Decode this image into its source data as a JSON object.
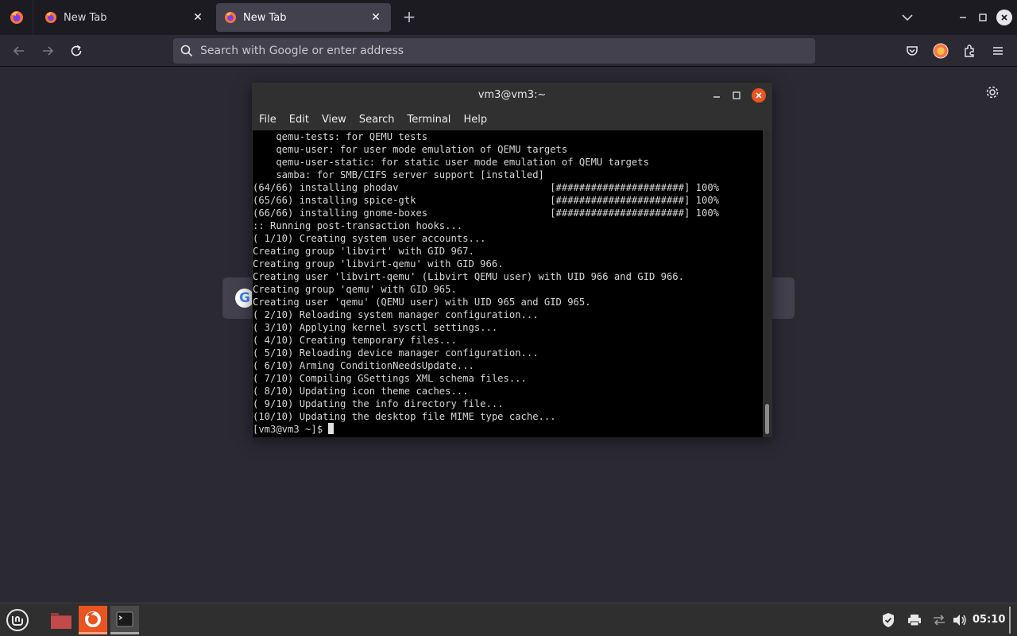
{
  "browser": {
    "tabs": [
      {
        "label": "New Tab",
        "active": false
      },
      {
        "label": "New Tab",
        "active": true
      }
    ],
    "new_tab_symbol": "+",
    "close_symbol": "✕",
    "urlbar": {
      "placeholder": "Search with Google or enter address",
      "value": ""
    },
    "icons": [
      "firefox-icon",
      "back-icon",
      "forward-icon",
      "reload-icon",
      "search-icon",
      "pocket-icon",
      "account-icon",
      "extensions-icon",
      "hamburger-menu-icon",
      "gear-icon",
      "google-icon"
    ],
    "google_letter": "G"
  },
  "terminal": {
    "title": "vm3@vm3:~",
    "menu": [
      "File",
      "Edit",
      "View",
      "Search",
      "Terminal",
      "Help"
    ],
    "lines": [
      "    qemu-tests: for QEMU tests",
      "    qemu-user: for user mode emulation of QEMU targets",
      "    qemu-user-static: for static user mode emulation of QEMU targets",
      "    samba: for SMB/CIFS server support [installed]",
      "(64/66) installing phodav                          [######################] 100%",
      "(65/66) installing spice-gtk                       [######################] 100%",
      "(66/66) installing gnome-boxes                     [######################] 100%",
      ":: Running post-transaction hooks...",
      "( 1/10) Creating system user accounts...",
      "Creating group 'libvirt' with GID 967.",
      "Creating group 'libvirt-qemu' with GID 966.",
      "Creating user 'libvirt-qemu' (Libvirt QEMU user) with UID 966 and GID 966.",
      "Creating group 'qemu' with GID 965.",
      "Creating user 'qemu' (QEMU user) with UID 965 and GID 965.",
      "( 2/10) Reloading system manager configuration...",
      "( 3/10) Applying kernel sysctl settings...",
      "( 4/10) Creating temporary files...",
      "( 5/10) Reloading device manager configuration...",
      "( 6/10) Arming ConditionNeedsUpdate...",
      "( 7/10) Compiling GSettings XML schema files...",
      "( 8/10) Updating icon theme caches...",
      "( 9/10) Updating the info directory file...",
      "(10/10) Updating the desktop file MIME type cache..."
    ],
    "prompt": "[vm3@vm3 ~]$ ",
    "colors": {
      "background": "#000000",
      "text": "#d6d6d6",
      "close_button": "#e95420"
    }
  },
  "taskbar": {
    "items": [
      "mint-menu-icon",
      "files-folder-icon",
      "firefox-icon",
      "terminal-icon"
    ],
    "tray": [
      "shield-icon",
      "printer-icon",
      "network-icon",
      "volume-icon"
    ],
    "clock": "05:10"
  }
}
